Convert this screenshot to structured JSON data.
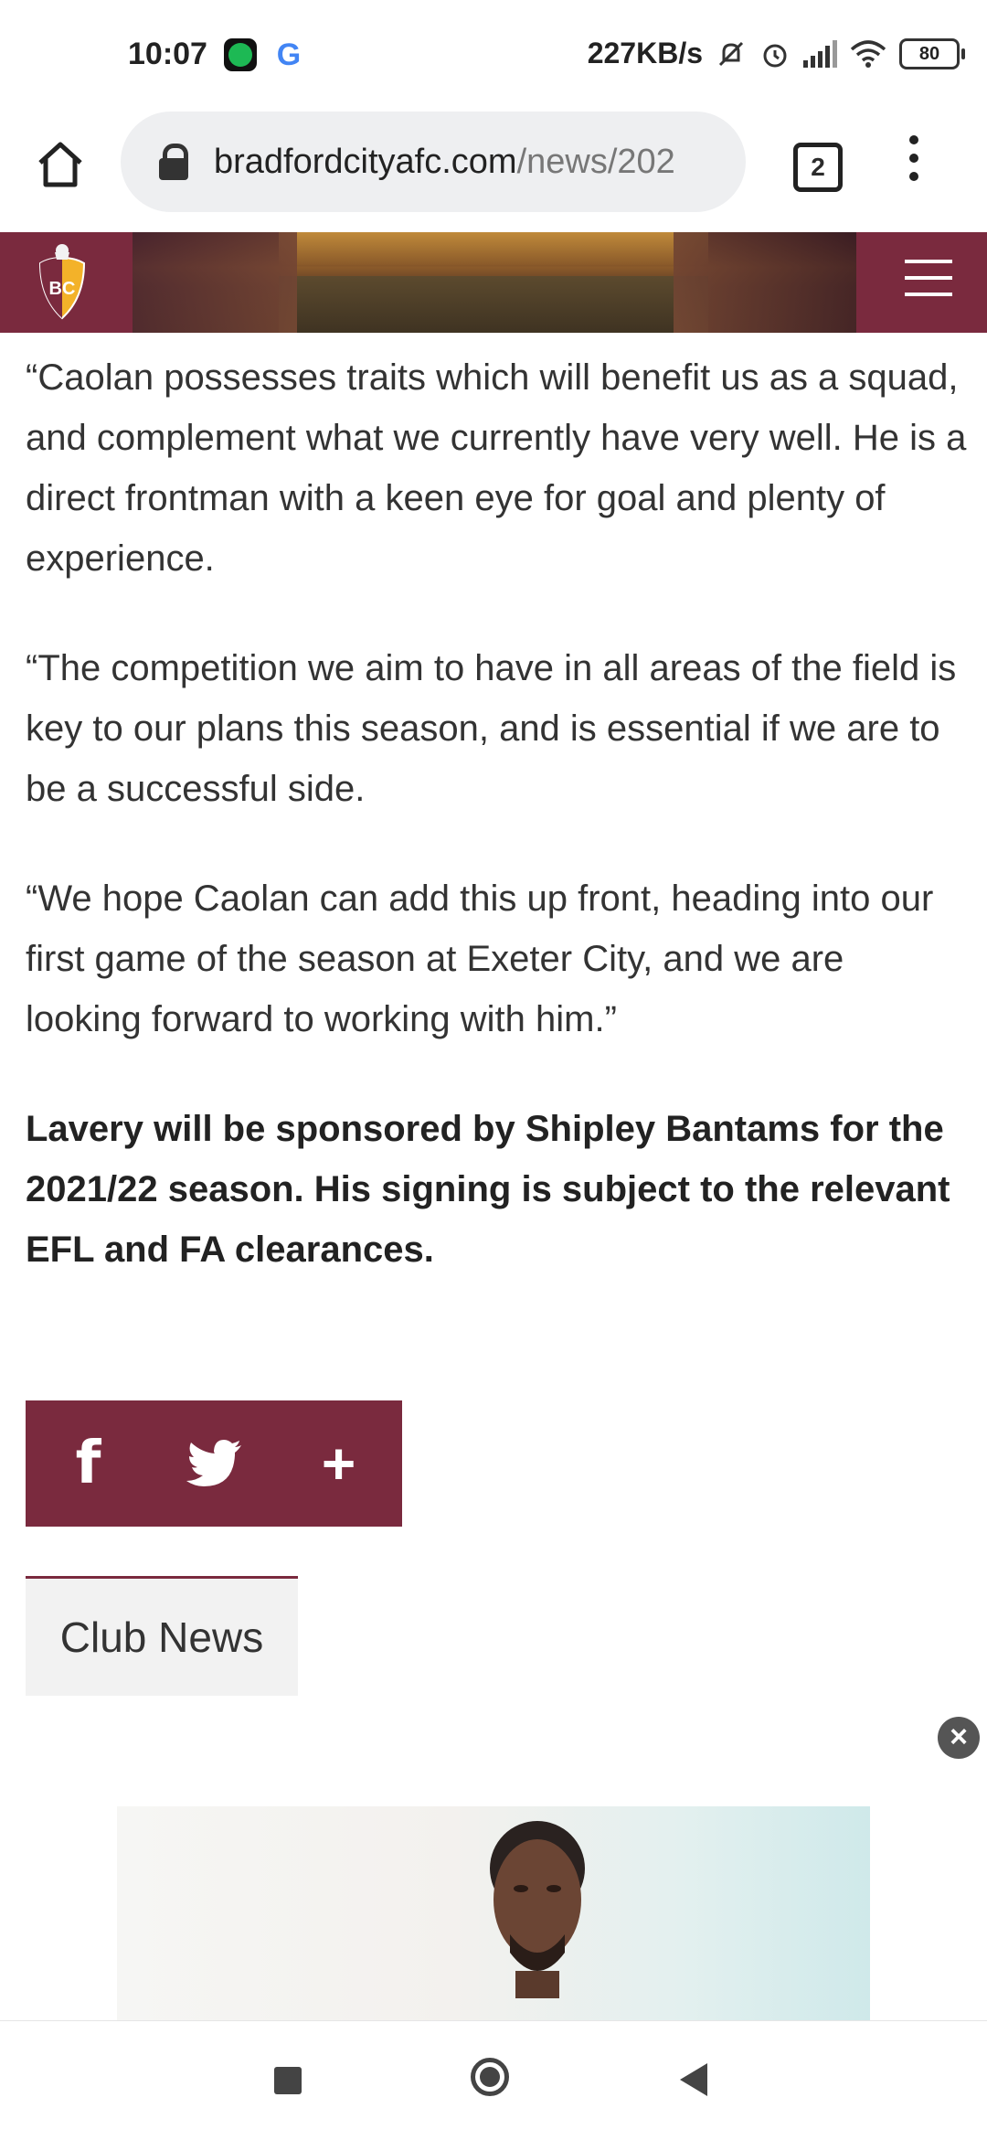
{
  "status_bar": {
    "time": "10:07",
    "net_speed": "227KB/s",
    "battery": "80",
    "icons": [
      "spotify-icon",
      "google-icon",
      "mute-icon",
      "alarm-icon",
      "signal-icon",
      "wifi-icon",
      "battery-icon"
    ]
  },
  "browser": {
    "url_host": "bradfordcityafc.com",
    "url_path": "/news/202",
    "tab_count": "2"
  },
  "article": {
    "paragraphs": [
      "“Caolan possesses traits which will benefit us as a squad, and complement what we currently have very well. He is a direct frontman with a keen eye for goal and plenty of experience.",
      "“The competition we aim to have in all areas of the field is key to our plans this season, and is essential if we are to be a successful side.",
      "“We hope Caolan can add this up front, heading into our first game of the season at Exeter City, and we are looking forward to working with him.”"
    ],
    "bold_paragraph": "Lavery will be sponsored by Shipley Bantams for the 2021/22 season. His signing is subject to the relevant EFL and FA clearances."
  },
  "share": {
    "facebook": "f",
    "plus": "+"
  },
  "tag": {
    "label": "Club News"
  },
  "ad": {
    "close": "×"
  },
  "colors": {
    "brand_claret": "#7a2a3e",
    "chip_background": "#f2f2f2"
  }
}
